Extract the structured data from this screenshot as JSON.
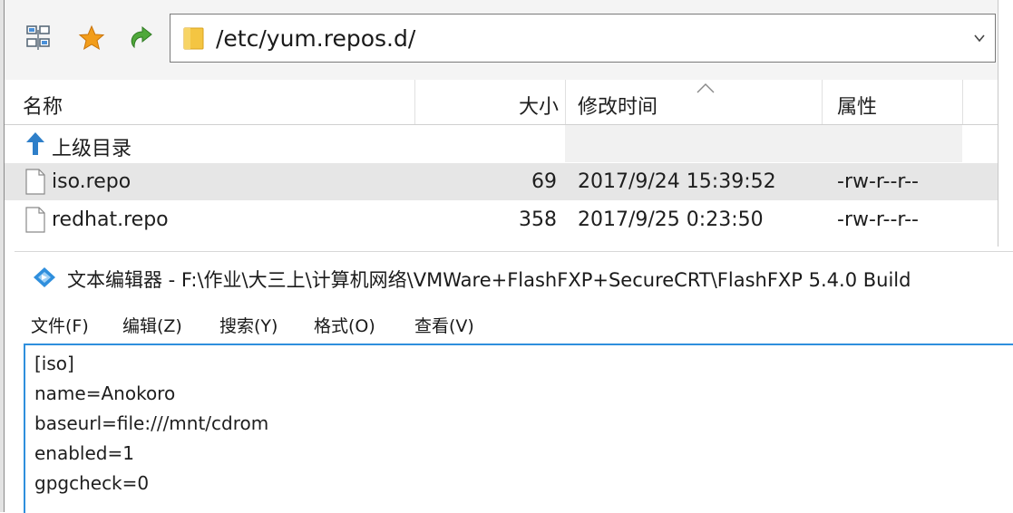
{
  "toolbar": {
    "icons": [
      "network-sites-icon",
      "favorites-star-icon",
      "refresh-icon"
    ],
    "path": "/etc/yum.repos.d/"
  },
  "file_list": {
    "columns": [
      "名称",
      "大小",
      "修改时间",
      "属性"
    ],
    "parent_dir_label": "上级目录",
    "rows": [
      {
        "name": "iso.repo",
        "size": "69",
        "modified": "2017/9/24 15:39:52",
        "attributes": "-rw-r--r--",
        "selected": true
      },
      {
        "name": "redhat.repo",
        "size": "358",
        "modified": "2017/9/25 0:23:50",
        "attributes": "-rw-r--r--",
        "selected": false
      }
    ]
  },
  "editor": {
    "title": "文本编辑器 - F:\\作业\\大三上\\计算机网络\\VMWare+FlashFXP+SecureCRT\\FlashFXP 5.4.0 Build",
    "menu": [
      "文件(F)",
      "编辑(Z)",
      "搜索(Y)",
      "格式(O)",
      "查看(V)"
    ],
    "lines": [
      "[iso]",
      "name=Anokoro",
      "baseurl=file:///mnt/cdrom",
      "enabled=1",
      "gpgcheck=0"
    ]
  },
  "colors": {
    "accent_blue": "#2f8fdd",
    "selected_row": "#e6e6e6",
    "folder_yellow": "#f4c542",
    "star_orange": "#f29d1b",
    "refresh_green": "#4fa83a"
  }
}
